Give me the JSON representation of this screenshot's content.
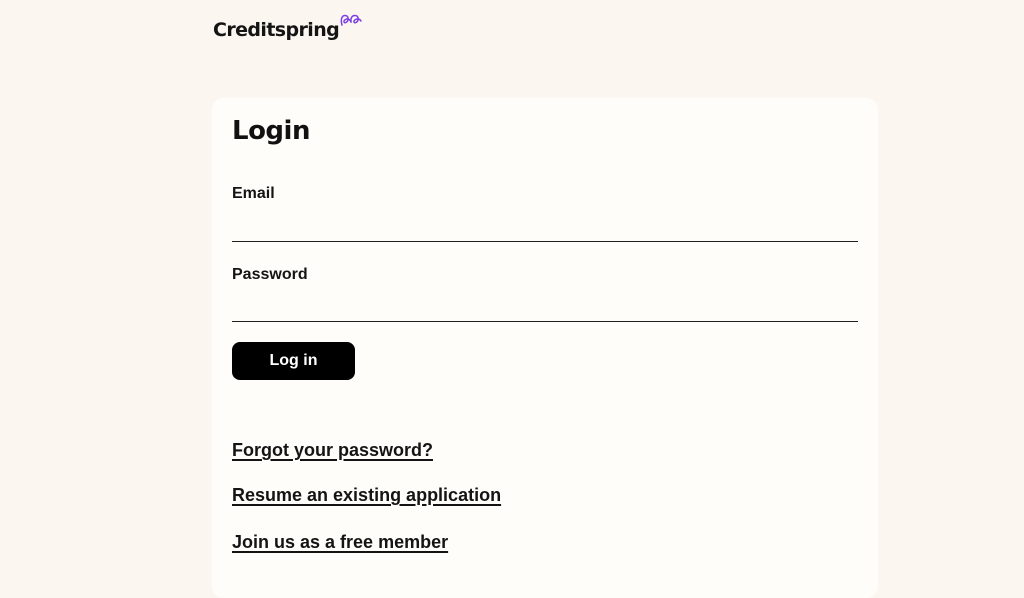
{
  "brand": {
    "name": "Creditspring",
    "logo_icon": "double-loop-logo-icon",
    "accent_color": "#7b3fe4"
  },
  "login_form": {
    "title": "Login",
    "email_label": "Email",
    "email_value": "",
    "password_label": "Password",
    "password_value": "",
    "submit_label": "Log in"
  },
  "links": {
    "forgot_password": "Forgot your password?",
    "resume_application": "Resume an existing application",
    "join_member": "Join us as a free member"
  },
  "colors": {
    "page_background": "#fbf6f0",
    "card_background": "#fffdfa",
    "button_background": "#000000",
    "button_text": "#ffffff"
  }
}
